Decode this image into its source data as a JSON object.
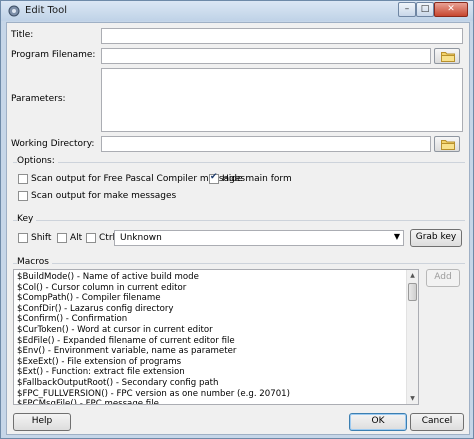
{
  "window": {
    "title": "Edit Tool",
    "buttons": {
      "minimize": "–",
      "maximize": "□",
      "close": "✕"
    }
  },
  "form": {
    "title_label": "Title:",
    "title_value": "",
    "program_label": "Program Filename:",
    "program_value": "",
    "parameters_label": "Parameters:",
    "parameters_value": "",
    "workdir_label": "Working Directory:",
    "workdir_value": ""
  },
  "options": {
    "label": "Options:",
    "scan_fpc": {
      "label": "Scan output for Free Pascal Compiler messages",
      "checked": false
    },
    "hide_main": {
      "label": "Hide main form",
      "checked": true
    },
    "scan_make": {
      "label": "Scan output for make messages",
      "checked": false
    }
  },
  "key": {
    "label": "Key",
    "shift": {
      "label": "Shift",
      "checked": false
    },
    "alt": {
      "label": "Alt",
      "checked": false
    },
    "ctrl": {
      "label": "Ctrl",
      "checked": false
    },
    "combo_value": "Unknown",
    "grab_label": "Grab key"
  },
  "macros": {
    "label": "Macros",
    "add_label": "Add",
    "items": [
      "$BuildMode() - Name of active build mode",
      "$Col() - Cursor column in current editor",
      "$CompPath() - Compiler filename",
      "$ConfDir() - Lazarus config directory",
      "$Confirm() - Confirmation",
      "$CurToken() - Word at cursor in current editor",
      "$EdFile() - Expanded filename of current editor file",
      "$Env() - Environment variable, name as parameter",
      "$ExeExt() - File extension of programs",
      "$Ext() - Function: extract file extension",
      "$FallbackOutputRoot() - Secondary config path",
      "$FPC_FULLVERSION() - FPC version as one number (e.g. 20701)",
      "$FPCMsgFile() - FPC message file"
    ]
  },
  "footer": {
    "help_label": "Help",
    "ok_label": "OK",
    "cancel_label": "Cancel"
  }
}
